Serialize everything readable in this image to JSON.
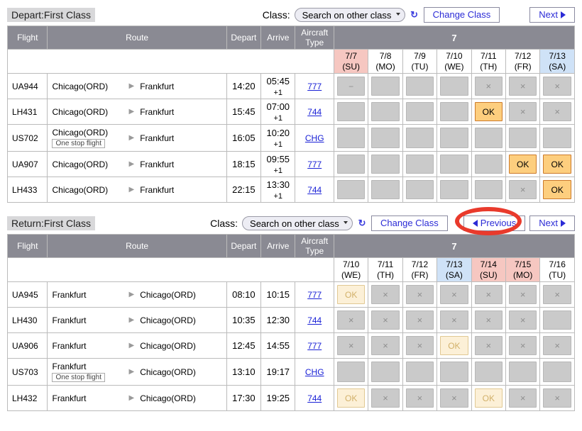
{
  "labels": {
    "class": "Class:",
    "class_select": "Search on other class",
    "change_class": "Change Class",
    "next": "Next",
    "previous": "Previous",
    "one_stop": "One stop flight"
  },
  "headers": {
    "flight": "Flight",
    "route": "Route",
    "depart": "Depart",
    "arrive": "Arrive",
    "aircraft_type": "Aircraft Type"
  },
  "depart": {
    "title": "Depart:First Class",
    "month": "7",
    "dates": [
      {
        "md": "7/7",
        "dow": "(SU)",
        "cls": "su"
      },
      {
        "md": "7/8",
        "dow": "(MO)",
        "cls": ""
      },
      {
        "md": "7/9",
        "dow": "(TU)",
        "cls": ""
      },
      {
        "md": "7/10",
        "dow": "(WE)",
        "cls": ""
      },
      {
        "md": "7/11",
        "dow": "(TH)",
        "cls": ""
      },
      {
        "md": "7/12",
        "dow": "(FR)",
        "cls": ""
      },
      {
        "md": "7/13",
        "dow": "(SA)",
        "cls": "sa"
      }
    ],
    "flights": [
      {
        "no": "UA944",
        "from": "Chicago(ORD)",
        "to": "Frankfurt",
        "onestop": false,
        "dep": "14:20",
        "arr": "05:45",
        "plus1": true,
        "ac": "777",
        "cells": [
          "dash",
          "blank",
          "blank",
          "blank",
          "x",
          "x",
          "x"
        ]
      },
      {
        "no": "LH431",
        "from": "Chicago(ORD)",
        "to": "Frankfurt",
        "onestop": false,
        "dep": "15:45",
        "arr": "07:00",
        "plus1": true,
        "ac": "744",
        "cells": [
          "blank",
          "blank",
          "blank",
          "blank",
          "ok",
          "x",
          "x"
        ]
      },
      {
        "no": "US702",
        "from": "Chicago(ORD)",
        "to": "Frankfurt",
        "onestop": true,
        "dep": "16:05",
        "arr": "10:20",
        "plus1": true,
        "ac": "CHG",
        "cells": [
          "blank",
          "blank",
          "blank",
          "blank",
          "blank",
          "blank",
          "blank"
        ]
      },
      {
        "no": "UA907",
        "from": "Chicago(ORD)",
        "to": "Frankfurt",
        "onestop": false,
        "dep": "18:15",
        "arr": "09:55",
        "plus1": true,
        "ac": "777",
        "cells": [
          "blank",
          "blank",
          "blank",
          "blank",
          "blank",
          "ok",
          "ok"
        ]
      },
      {
        "no": "LH433",
        "from": "Chicago(ORD)",
        "to": "Frankfurt",
        "onestop": false,
        "dep": "22:15",
        "arr": "13:30",
        "plus1": true,
        "ac": "744",
        "cells": [
          "blank",
          "blank",
          "blank",
          "blank",
          "blank",
          "x",
          "ok"
        ]
      }
    ]
  },
  "return": {
    "title": "Return:First Class",
    "month": "7",
    "dates": [
      {
        "md": "7/10",
        "dow": "(WE)",
        "cls": ""
      },
      {
        "md": "7/11",
        "dow": "(TH)",
        "cls": ""
      },
      {
        "md": "7/12",
        "dow": "(FR)",
        "cls": ""
      },
      {
        "md": "7/13",
        "dow": "(SA)",
        "cls": "sa"
      },
      {
        "md": "7/14",
        "dow": "(SU)",
        "cls": "su"
      },
      {
        "md": "7/15",
        "dow": "(MO)",
        "cls": "holiday"
      },
      {
        "md": "7/16",
        "dow": "(TU)",
        "cls": ""
      }
    ],
    "flights": [
      {
        "no": "UA945",
        "from": "Frankfurt",
        "to": "Chicago(ORD)",
        "onestop": false,
        "dep": "08:10",
        "arr": "10:15",
        "plus1": false,
        "ac": "777",
        "cells": [
          "ok-pale",
          "x",
          "x",
          "x",
          "x",
          "x",
          "x"
        ]
      },
      {
        "no": "LH430",
        "from": "Frankfurt",
        "to": "Chicago(ORD)",
        "onestop": false,
        "dep": "10:35",
        "arr": "12:30",
        "plus1": false,
        "ac": "744",
        "cells": [
          "x",
          "x",
          "x",
          "x",
          "x",
          "x",
          "blank"
        ]
      },
      {
        "no": "UA906",
        "from": "Frankfurt",
        "to": "Chicago(ORD)",
        "onestop": false,
        "dep": "12:45",
        "arr": "14:55",
        "plus1": false,
        "ac": "777",
        "cells": [
          "x",
          "x",
          "x",
          "ok-pale",
          "x",
          "x",
          "x"
        ]
      },
      {
        "no": "US703",
        "from": "Frankfurt",
        "to": "Chicago(ORD)",
        "onestop": true,
        "dep": "13:10",
        "arr": "19:17",
        "plus1": false,
        "ac": "CHG",
        "cells": [
          "blank",
          "blank",
          "blank",
          "blank",
          "blank",
          "blank",
          "blank"
        ]
      },
      {
        "no": "LH432",
        "from": "Frankfurt",
        "to": "Chicago(ORD)",
        "onestop": false,
        "dep": "17:30",
        "arr": "19:25",
        "plus1": false,
        "ac": "744",
        "cells": [
          "ok-pale",
          "x",
          "x",
          "x",
          "ok-pale",
          "x",
          "x"
        ]
      }
    ]
  }
}
